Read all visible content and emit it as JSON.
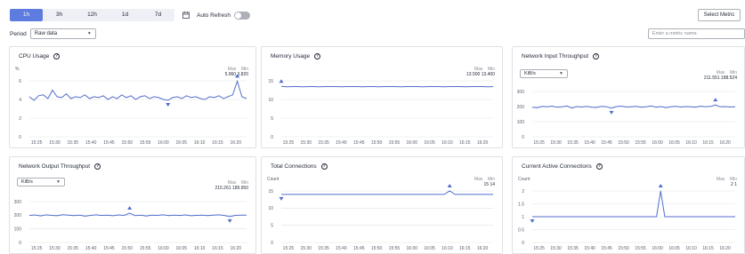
{
  "toolbar": {
    "ranges": [
      "1h",
      "3h",
      "12h",
      "1d",
      "7d"
    ],
    "active_range": "1h",
    "auto_refresh_label": "Auto Refresh",
    "auto_refresh_on": false,
    "select_metric_label": "Select Metric"
  },
  "period": {
    "label": "Period",
    "value": "Raw data"
  },
  "search": {
    "placeholder": "Enter a metric name."
  },
  "colors": {
    "accent": "#5e7ce0",
    "line": "#526ecc",
    "grid": "#dfe1e6"
  },
  "cards": [
    {
      "title": "CPU Usage",
      "unit": "%",
      "max_label": "Max",
      "min_label": "Min",
      "max": "5.960",
      "min": "3.820",
      "chart_data": {
        "type": "line",
        "ylim": [
          0,
          6
        ],
        "yticks": [
          "0",
          "2",
          "4",
          "6"
        ],
        "xticks": [
          "15:25",
          "15:30",
          "15:35",
          "15:40",
          "15:45",
          "15:50",
          "15:55",
          "16:00",
          "16:05",
          "16:10",
          "16:15",
          "16:20"
        ],
        "x_range": [
          "15:23",
          "16:23"
        ],
        "values": [
          4.3,
          3.9,
          4.4,
          4.5,
          4.1,
          5.0,
          4.3,
          4.2,
          4.6,
          4.1,
          4.3,
          4.2,
          4.5,
          4.1,
          4.3,
          4.2,
          4.4,
          4.0,
          4.3,
          4.1,
          4.5,
          4.2,
          4.4,
          4.0,
          4.3,
          4.4,
          4.1,
          4.3,
          4.2,
          4.0,
          3.9,
          4.2,
          4.3,
          4.1,
          4.4,
          4.2,
          4.3,
          4.1,
          4.0,
          4.3,
          4.2,
          4.4,
          4.1,
          4.3,
          4.5,
          5.96,
          4.3,
          4.1
        ],
        "max_index": 45,
        "min_index": 30
      }
    },
    {
      "title": "Memory Usage",
      "unit": "",
      "max_label": "Max",
      "min_label": "Min",
      "max": "13.500",
      "min": "13.400",
      "chart_data": {
        "type": "line",
        "ylim": [
          0,
          15
        ],
        "yticks": [
          "0",
          "5",
          "10",
          "15"
        ],
        "xticks": [
          "15:25",
          "15:30",
          "15:35",
          "15:40",
          "15:45",
          "15:50",
          "15:55",
          "16:00",
          "16:05",
          "16:10",
          "16:15",
          "16:20"
        ],
        "x_range": [
          "15:23",
          "16:23"
        ],
        "values": [
          13.5,
          13.4,
          13.45,
          13.45,
          13.4,
          13.45,
          13.45,
          13.4,
          13.45,
          13.45,
          13.45,
          13.4,
          13.45,
          13.45,
          13.45,
          13.4,
          13.45,
          13.45,
          13.4,
          13.45,
          13.45,
          13.45,
          13.4,
          13.45,
          13.45,
          13.45,
          13.4,
          13.45,
          13.45,
          13.45,
          13.4,
          13.45,
          13.45,
          13.45,
          13.4,
          13.45,
          13.45,
          13.45,
          13.4,
          13.45
        ],
        "max_index": 0,
        "min_index": -1
      }
    },
    {
      "title": "Network Input Throughput",
      "unit": "",
      "dropdown": "KiB/s",
      "max_label": "Max",
      "min_label": "Min",
      "max": "211.551",
      "min": "188.524",
      "chart_data": {
        "type": "line",
        "ylim": [
          0,
          300
        ],
        "yticks": [
          "0",
          "100",
          "200",
          "300"
        ],
        "xticks": [
          "15:25",
          "15:30",
          "15:35",
          "15:40",
          "15:45",
          "15:50",
          "15:55",
          "16:00",
          "16:05",
          "16:10",
          "16:15",
          "16:20"
        ],
        "x_range": [
          "15:23",
          "16:23"
        ],
        "values": [
          196,
          192,
          201,
          198,
          203,
          195,
          199,
          204,
          190,
          200,
          197,
          202,
          196,
          194,
          201,
          199,
          189,
          200,
          203,
          197,
          199,
          201,
          195,
          198,
          204,
          196,
          200,
          193,
          199,
          202,
          197,
          200,
          198,
          196,
          203,
          199,
          201,
          211,
          198,
          200,
          197,
          199
        ],
        "max_index": 37,
        "min_index": 16
      }
    },
    {
      "title": "Network Output Throughput",
      "unit": "",
      "dropdown": "KiB/s",
      "max_label": "Max",
      "min_label": "Min",
      "max": "215.261",
      "min": "189.950",
      "chart_data": {
        "type": "line",
        "ylim": [
          0,
          300
        ],
        "yticks": [
          "0",
          "100",
          "200",
          "300"
        ],
        "xticks": [
          "15:25",
          "15:30",
          "15:35",
          "15:40",
          "15:45",
          "15:50",
          "15:55",
          "16:00",
          "16:05",
          "16:10",
          "16:15",
          "16:20"
        ],
        "x_range": [
          "15:23",
          "16:23"
        ],
        "values": [
          198,
          202,
          195,
          203,
          199,
          196,
          204,
          200,
          197,
          201,
          193,
          199,
          203,
          198,
          200,
          196,
          202,
          199,
          215,
          197,
          200,
          194,
          201,
          199,
          203,
          197,
          200,
          198,
          202,
          196,
          199,
          201,
          197,
          200,
          203,
          198,
          190,
          199,
          201,
          200
        ],
        "max_index": 18,
        "min_index": 36
      }
    },
    {
      "title": "Total Connections",
      "unit": "Count",
      "max_label": "Max",
      "min_label": "Min",
      "max": "15",
      "min": "14",
      "chart_data": {
        "type": "line",
        "ylim": [
          0,
          15
        ],
        "yticks": [
          "0",
          "5",
          "10",
          "15"
        ],
        "xticks": [
          "15:25",
          "15:30",
          "15:35",
          "15:40",
          "15:45",
          "15:50",
          "15:55",
          "16:00",
          "16:05",
          "16:10",
          "16:15",
          "16:20"
        ],
        "x_range": [
          "15:23",
          "16:23"
        ],
        "values": [
          14,
          14,
          14,
          14,
          14,
          14,
          14,
          14,
          14,
          14,
          14,
          14,
          14,
          14,
          14,
          14,
          14,
          14,
          14,
          14,
          14,
          14,
          14,
          14,
          14,
          14,
          14,
          14,
          14,
          14,
          14,
          15,
          14,
          14,
          14,
          14,
          14,
          14,
          14,
          14
        ],
        "max_index": 31,
        "min_index": 0
      }
    },
    {
      "title": "Current Active Connections",
      "unit": "Count",
      "max_label": "Max",
      "min_label": "Min",
      "max": "2",
      "min": "1",
      "chart_data": {
        "type": "line",
        "ylim": [
          0,
          2
        ],
        "yticks": [
          "0",
          "0.5",
          "1",
          "1.5",
          "2"
        ],
        "xticks": [
          "15:25",
          "15:30",
          "15:35",
          "15:40",
          "15:45",
          "15:50",
          "15:55",
          "16:00",
          "16:05",
          "16:10",
          "16:15",
          "16:20"
        ],
        "x_range": [
          "15:23",
          "16:23"
        ],
        "values": [
          1,
          1,
          1,
          1,
          1,
          1,
          1,
          1,
          1,
          1,
          1,
          1,
          1,
          1,
          1,
          1,
          1,
          1,
          1,
          1,
          1,
          1,
          1,
          1,
          1,
          1,
          1,
          1,
          1,
          1,
          1,
          2,
          1,
          1,
          1,
          1,
          1,
          1,
          1,
          1,
          1,
          1,
          1,
          1,
          1,
          1,
          1,
          1,
          1,
          1
        ],
        "max_index": 31,
        "min_index": 0
      }
    }
  ]
}
